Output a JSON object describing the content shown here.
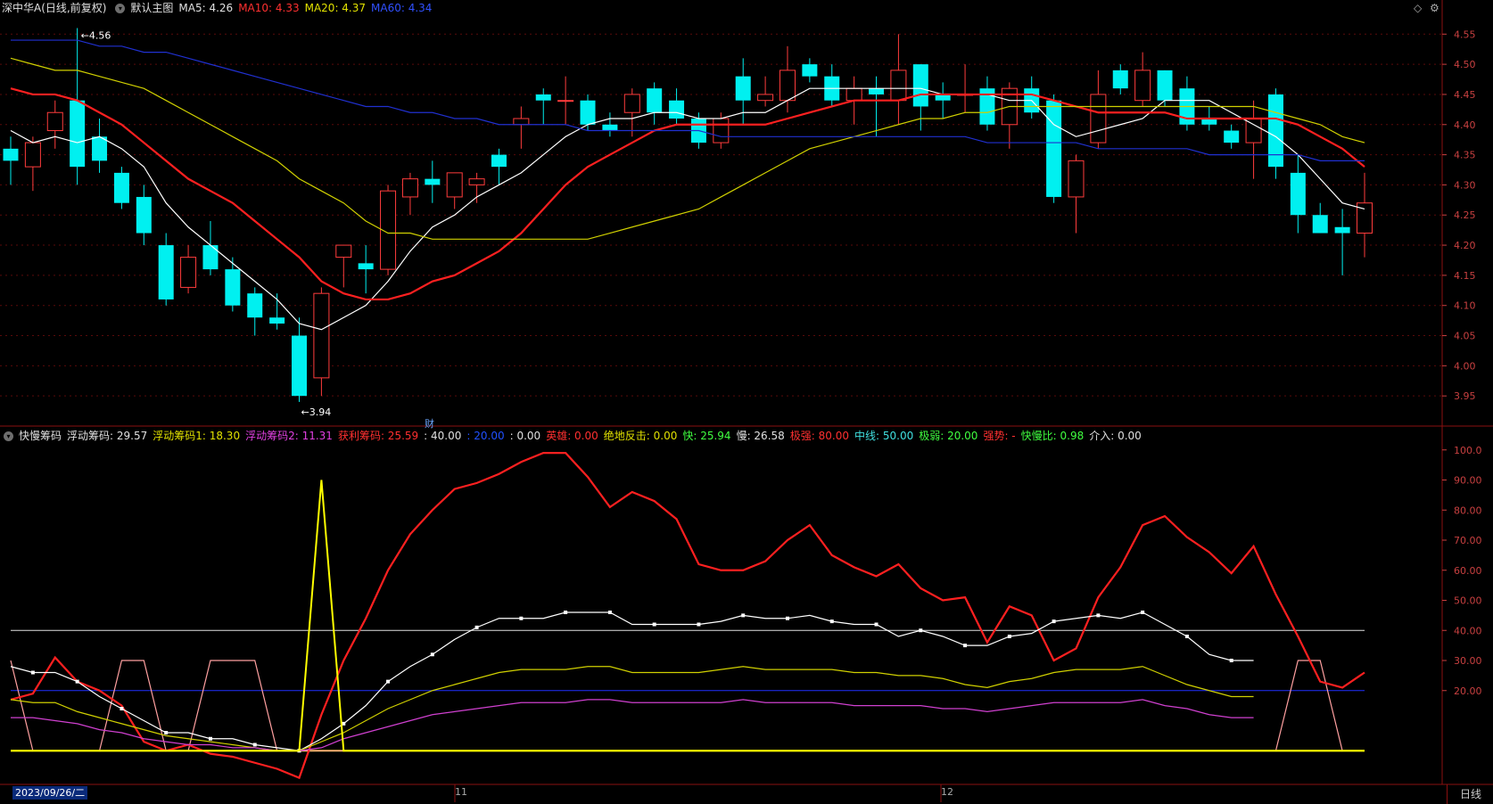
{
  "top_header": {
    "stock": "深中华A(日线,前复权)",
    "main_label": "默认主图",
    "ma5": "MA5: 4.26",
    "ma10": "MA10: 4.33",
    "ma20": "MA20: 4.37",
    "ma60": "MA60: 4.34"
  },
  "bottom_header": {
    "name": "快慢筹码",
    "items": [
      {
        "text": "浮动筹码: 29.57",
        "color": "#e0e0e0"
      },
      {
        "text": "浮动筹码1: 18.30",
        "color": "#e0e000"
      },
      {
        "text": "浮动筹码2: 11.31",
        "color": "#e040e0"
      },
      {
        "text": "获利筹码: 25.59",
        "color": "#ff3030"
      },
      {
        "text": ": 40.00",
        "color": "#e0e0e0"
      },
      {
        "text": ": 20.00",
        "color": "#2050ff"
      },
      {
        "text": ": 0.00",
        "color": "#e0e0e0"
      },
      {
        "text": "英雄: 0.00",
        "color": "#ff3030"
      },
      {
        "text": "绝地反击: 0.00",
        "color": "#e0e000"
      },
      {
        "text": "快: 25.94",
        "color": "#40ff40"
      },
      {
        "text": "慢: 26.58",
        "color": "#e0e0e0"
      },
      {
        "text": "极强: 80.00",
        "color": "#ff3030"
      },
      {
        "text": "中线: 50.00",
        "color": "#40e0e0"
      },
      {
        "text": "极弱: 20.00",
        "color": "#40ff40"
      },
      {
        "text": "强势: -",
        "color": "#ff3030"
      },
      {
        "text": "快慢比: 0.98",
        "color": "#40ff40"
      },
      {
        "text": "介入: 0.00",
        "color": "#e0e0e0"
      }
    ]
  },
  "marks": {
    "high": "4.56",
    "low": "3.94",
    "cai": "财",
    "month_nov": "11",
    "month_dec": "12"
  },
  "bottom_bar": {
    "date": "2023/09/26/二",
    "tab": "日线"
  },
  "chart_data": [
    {
      "type": "candlestick",
      "ylim": [
        3.9,
        4.58
      ],
      "yticks": [
        "4.55",
        "4.50",
        "4.45",
        "4.40",
        "4.35",
        "4.30",
        "4.25",
        "4.20",
        "4.15",
        "4.10",
        "4.05",
        "4.00",
        "3.95"
      ],
      "candles": [
        {
          "o": 4.36,
          "h": 4.38,
          "l": 4.3,
          "c": 4.34
        },
        {
          "o": 4.33,
          "h": 4.38,
          "l": 4.29,
          "c": 4.37
        },
        {
          "o": 4.39,
          "h": 4.44,
          "l": 4.36,
          "c": 4.42
        },
        {
          "o": 4.44,
          "h": 4.56,
          "l": 4.3,
          "c": 4.33
        },
        {
          "o": 4.38,
          "h": 4.41,
          "l": 4.32,
          "c": 4.34
        },
        {
          "o": 4.32,
          "h": 4.33,
          "l": 4.26,
          "c": 4.27
        },
        {
          "o": 4.28,
          "h": 4.3,
          "l": 4.2,
          "c": 4.22
        },
        {
          "o": 4.2,
          "h": 4.22,
          "l": 4.1,
          "c": 4.11
        },
        {
          "o": 4.13,
          "h": 4.2,
          "l": 4.12,
          "c": 4.18
        },
        {
          "o": 4.2,
          "h": 4.24,
          "l": 4.15,
          "c": 4.16
        },
        {
          "o": 4.16,
          "h": 4.18,
          "l": 4.09,
          "c": 4.1
        },
        {
          "o": 4.12,
          "h": 4.13,
          "l": 4.05,
          "c": 4.08
        },
        {
          "o": 4.08,
          "h": 4.12,
          "l": 4.06,
          "c": 4.07
        },
        {
          "o": 4.05,
          "h": 4.08,
          "l": 3.94,
          "c": 3.95
        },
        {
          "o": 3.98,
          "h": 4.13,
          "l": 3.95,
          "c": 4.12
        },
        {
          "o": 4.18,
          "h": 4.2,
          "l": 4.13,
          "c": 4.2
        },
        {
          "o": 4.17,
          "h": 4.2,
          "l": 4.12,
          "c": 4.16
        },
        {
          "o": 4.16,
          "h": 4.3,
          "l": 4.15,
          "c": 4.29
        },
        {
          "o": 4.28,
          "h": 4.32,
          "l": 4.25,
          "c": 4.31
        },
        {
          "o": 4.31,
          "h": 4.34,
          "l": 4.27,
          "c": 4.3
        },
        {
          "o": 4.28,
          "h": 4.32,
          "l": 4.26,
          "c": 4.32
        },
        {
          "o": 4.3,
          "h": 4.32,
          "l": 4.27,
          "c": 4.31
        },
        {
          "o": 4.35,
          "h": 4.36,
          "l": 4.3,
          "c": 4.33
        },
        {
          "o": 4.4,
          "h": 4.43,
          "l": 4.36,
          "c": 4.41
        },
        {
          "o": 4.45,
          "h": 4.46,
          "l": 4.4,
          "c": 4.44
        },
        {
          "o": 4.44,
          "h": 4.48,
          "l": 4.4,
          "c": 4.44
        },
        {
          "o": 4.44,
          "h": 4.45,
          "l": 4.39,
          "c": 4.4
        },
        {
          "o": 4.4,
          "h": 4.42,
          "l": 4.38,
          "c": 4.39
        },
        {
          "o": 4.42,
          "h": 4.46,
          "l": 4.38,
          "c": 4.45
        },
        {
          "o": 4.46,
          "h": 4.47,
          "l": 4.4,
          "c": 4.42
        },
        {
          "o": 4.44,
          "h": 4.46,
          "l": 4.4,
          "c": 4.41
        },
        {
          "o": 4.41,
          "h": 4.42,
          "l": 4.36,
          "c": 4.37
        },
        {
          "o": 4.37,
          "h": 4.42,
          "l": 4.36,
          "c": 4.41
        },
        {
          "o": 4.48,
          "h": 4.51,
          "l": 4.4,
          "c": 4.44
        },
        {
          "o": 4.44,
          "h": 4.48,
          "l": 4.43,
          "c": 4.45
        },
        {
          "o": 4.44,
          "h": 4.53,
          "l": 4.42,
          "c": 4.49
        },
        {
          "o": 4.5,
          "h": 4.51,
          "l": 4.47,
          "c": 4.48
        },
        {
          "o": 4.48,
          "h": 4.5,
          "l": 4.43,
          "c": 4.44
        },
        {
          "o": 4.44,
          "h": 4.48,
          "l": 4.4,
          "c": 4.46
        },
        {
          "o": 4.46,
          "h": 4.48,
          "l": 4.38,
          "c": 4.45
        },
        {
          "o": 4.44,
          "h": 4.55,
          "l": 4.4,
          "c": 4.49
        },
        {
          "o": 4.5,
          "h": 4.5,
          "l": 4.39,
          "c": 4.43
        },
        {
          "o": 4.45,
          "h": 4.47,
          "l": 4.41,
          "c": 4.44
        },
        {
          "o": 4.45,
          "h": 4.5,
          "l": 4.42,
          "c": 4.45
        },
        {
          "o": 4.46,
          "h": 4.48,
          "l": 4.39,
          "c": 4.4
        },
        {
          "o": 4.4,
          "h": 4.47,
          "l": 4.36,
          "c": 4.46
        },
        {
          "o": 4.46,
          "h": 4.48,
          "l": 4.41,
          "c": 4.42
        },
        {
          "o": 4.44,
          "h": 4.45,
          "l": 4.27,
          "c": 4.28
        },
        {
          "o": 4.28,
          "h": 4.35,
          "l": 4.22,
          "c": 4.34
        },
        {
          "o": 4.37,
          "h": 4.49,
          "l": 4.36,
          "c": 4.45
        },
        {
          "o": 4.49,
          "h": 4.5,
          "l": 4.45,
          "c": 4.46
        },
        {
          "o": 4.44,
          "h": 4.52,
          "l": 4.43,
          "c": 4.49
        },
        {
          "o": 4.49,
          "h": 4.49,
          "l": 4.43,
          "c": 4.44
        },
        {
          "o": 4.46,
          "h": 4.48,
          "l": 4.39,
          "c": 4.4
        },
        {
          "o": 4.41,
          "h": 4.43,
          "l": 4.39,
          "c": 4.4
        },
        {
          "o": 4.39,
          "h": 4.4,
          "l": 4.36,
          "c": 4.37
        },
        {
          "o": 4.37,
          "h": 4.44,
          "l": 4.31,
          "c": 4.41
        },
        {
          "o": 4.45,
          "h": 4.46,
          "l": 4.31,
          "c": 4.33
        },
        {
          "o": 4.32,
          "h": 4.35,
          "l": 4.22,
          "c": 4.25
        },
        {
          "o": 4.25,
          "h": 4.27,
          "l": 4.22,
          "c": 4.22
        },
        {
          "o": 4.23,
          "h": 4.26,
          "l": 4.15,
          "c": 4.22
        },
        {
          "o": 4.22,
          "h": 4.32,
          "l": 4.18,
          "c": 4.27
        }
      ],
      "ma": [
        {
          "name": "MA5",
          "color": "#ffffff",
          "values": [
            4.39,
            4.37,
            4.38,
            4.37,
            4.38,
            4.36,
            4.33,
            4.27,
            4.23,
            4.2,
            4.17,
            4.14,
            4.11,
            4.07,
            4.06,
            4.08,
            4.1,
            4.14,
            4.19,
            4.23,
            4.25,
            4.28,
            4.3,
            4.32,
            4.35,
            4.38,
            4.4,
            4.41,
            4.41,
            4.42,
            4.42,
            4.41,
            4.41,
            4.42,
            4.42,
            4.44,
            4.46,
            4.46,
            4.46,
            4.46,
            4.46,
            4.46,
            4.45,
            4.45,
            4.45,
            4.44,
            4.44,
            4.4,
            4.38,
            4.39,
            4.4,
            4.41,
            4.44,
            4.44,
            4.44,
            4.42,
            4.4,
            4.38,
            4.35,
            4.31,
            4.27,
            4.26
          ]
        },
        {
          "name": "MA10",
          "color": "#ff2020",
          "values": [
            4.46,
            4.45,
            4.45,
            4.44,
            4.42,
            4.4,
            4.37,
            4.34,
            4.31,
            4.29,
            4.27,
            4.24,
            4.21,
            4.18,
            4.14,
            4.12,
            4.11,
            4.11,
            4.12,
            4.14,
            4.15,
            4.17,
            4.19,
            4.22,
            4.26,
            4.3,
            4.33,
            4.35,
            4.37,
            4.39,
            4.4,
            4.4,
            4.4,
            4.4,
            4.4,
            4.41,
            4.42,
            4.43,
            4.44,
            4.44,
            4.44,
            4.45,
            4.45,
            4.45,
            4.45,
            4.45,
            4.45,
            4.44,
            4.43,
            4.42,
            4.42,
            4.42,
            4.42,
            4.41,
            4.41,
            4.41,
            4.41,
            4.41,
            4.4,
            4.38,
            4.36,
            4.33
          ]
        },
        {
          "name": "MA20",
          "color": "#d0d000",
          "values": [
            4.51,
            4.5,
            4.49,
            4.49,
            4.48,
            4.47,
            4.46,
            4.44,
            4.42,
            4.4,
            4.38,
            4.36,
            4.34,
            4.31,
            4.29,
            4.27,
            4.24,
            4.22,
            4.22,
            4.21,
            4.21,
            4.21,
            4.21,
            4.21,
            4.21,
            4.21,
            4.21,
            4.22,
            4.23,
            4.24,
            4.25,
            4.26,
            4.28,
            4.3,
            4.32,
            4.34,
            4.36,
            4.37,
            4.38,
            4.39,
            4.4,
            4.41,
            4.41,
            4.42,
            4.42,
            4.43,
            4.43,
            4.43,
            4.43,
            4.43,
            4.43,
            4.43,
            4.43,
            4.43,
            4.43,
            4.43,
            4.43,
            4.42,
            4.41,
            4.4,
            4.38,
            4.37
          ]
        },
        {
          "name": "MA60",
          "color": "#2030d0",
          "values": [
            4.54,
            4.54,
            4.54,
            4.54,
            4.53,
            4.53,
            4.52,
            4.52,
            4.51,
            4.5,
            4.49,
            4.48,
            4.47,
            4.46,
            4.45,
            4.44,
            4.43,
            4.43,
            4.42,
            4.42,
            4.41,
            4.41,
            4.4,
            4.4,
            4.4,
            4.4,
            4.39,
            4.39,
            4.39,
            4.39,
            4.39,
            4.39,
            4.38,
            4.38,
            4.38,
            4.38,
            4.38,
            4.38,
            4.38,
            4.38,
            4.38,
            4.38,
            4.38,
            4.38,
            4.37,
            4.37,
            4.37,
            4.37,
            4.37,
            4.36,
            4.36,
            4.36,
            4.36,
            4.36,
            4.35,
            4.35,
            4.35,
            4.35,
            4.35,
            4.34,
            4.34,
            4.34
          ]
        }
      ]
    },
    {
      "type": "line",
      "ylim": [
        -10,
        102
      ],
      "yticks": [
        "100.0",
        "90.00",
        "80.00",
        "70.00",
        "60.00",
        "50.00",
        "40.00",
        "30.00",
        "20.00"
      ],
      "hlines": [
        {
          "value": 40,
          "color": "#e0e0e0"
        },
        {
          "value": 20,
          "color": "#2030ff"
        },
        {
          "value": 0,
          "color": "#e0e000"
        }
      ],
      "series": [
        {
          "name": "获利筹码",
          "color": "#ff2020",
          "values": [
            17,
            19,
            31,
            23,
            20,
            15,
            3,
            0,
            2,
            -1,
            -2,
            -4,
            -6,
            -9,
            12,
            30,
            44,
            60,
            72,
            80,
            87,
            89,
            92,
            96,
            99,
            99,
            91,
            81,
            86,
            83,
            77,
            62,
            60,
            60,
            63,
            70,
            75,
            65,
            61,
            58,
            62,
            54,
            50,
            51,
            36,
            48,
            45,
            30,
            34,
            51,
            61,
            75,
            78,
            71,
            66,
            59,
            68,
            52,
            38,
            23,
            21,
            26
          ]
        },
        {
          "name": "浮动筹码",
          "color": "#ffffff",
          "dots": true,
          "values": [
            28,
            26,
            26,
            23,
            18,
            14,
            10,
            6,
            6,
            4,
            4,
            2,
            1,
            0,
            4,
            9,
            15,
            23,
            28,
            32,
            37,
            41,
            44,
            44,
            44,
            46,
            46,
            46,
            42,
            42,
            42,
            42,
            43,
            45,
            44,
            44,
            45,
            43,
            42,
            42,
            38,
            40,
            38,
            35,
            35,
            38,
            39,
            43,
            44,
            45,
            44,
            46,
            42,
            38,
            32,
            30,
            30
          ]
        },
        {
          "name": "浮动筹码1",
          "color": "#d0d000",
          "values": [
            17,
            16,
            16,
            13,
            11,
            9,
            7,
            5,
            4,
            3,
            2,
            1,
            0,
            0,
            3,
            6,
            10,
            14,
            17,
            20,
            22,
            24,
            26,
            27,
            27,
            27,
            28,
            28,
            26,
            26,
            26,
            26,
            27,
            28,
            27,
            27,
            27,
            27,
            26,
            26,
            25,
            25,
            24,
            22,
            21,
            23,
            24,
            26,
            27,
            27,
            27,
            28,
            25,
            22,
            20,
            18,
            18
          ]
        },
        {
          "name": "浮动筹码2",
          "color": "#d040d0",
          "values": [
            11,
            11,
            10,
            9,
            7,
            6,
            4,
            3,
            2,
            2,
            1,
            1,
            0,
            0,
            1,
            4,
            6,
            8,
            10,
            12,
            13,
            14,
            15,
            16,
            16,
            16,
            17,
            17,
            16,
            16,
            16,
            16,
            16,
            17,
            16,
            16,
            16,
            16,
            15,
            15,
            15,
            15,
            14,
            14,
            13,
            14,
            15,
            16,
            16,
            16,
            16,
            17,
            15,
            14,
            12,
            11,
            11
          ]
        }
      ],
      "pulse_yellow": {
        "color": "#ffff00",
        "values": [
          0,
          0,
          0,
          0,
          0,
          0,
          0,
          0,
          0,
          0,
          0,
          0,
          0,
          0,
          90,
          0,
          0,
          0,
          0,
          0,
          0,
          0,
          0,
          0,
          0,
          0,
          0,
          0,
          0,
          0,
          0,
          0,
          0,
          0,
          0,
          0,
          0,
          0,
          0,
          0,
          0,
          0,
          0,
          0,
          0,
          0,
          0,
          0,
          0,
          0,
          0,
          0,
          0,
          0,
          0,
          0,
          0,
          0,
          0,
          0,
          0,
          0
        ]
      },
      "pulse_pink": {
        "color": "#ffa0a0",
        "values": [
          30,
          0,
          0,
          0,
          0,
          30,
          30,
          0,
          0,
          30,
          30,
          30,
          0,
          0,
          0,
          0,
          0,
          0,
          0,
          0,
          0,
          0,
          0,
          0,
          0,
          0,
          0,
          0,
          0,
          0,
          0,
          0,
          0,
          0,
          0,
          0,
          0,
          0,
          0,
          0,
          0,
          0,
          0,
          0,
          0,
          0,
          0,
          0,
          0,
          0,
          0,
          0,
          0,
          0,
          0,
          0,
          0,
          0,
          30,
          30,
          0,
          0
        ]
      }
    }
  ]
}
